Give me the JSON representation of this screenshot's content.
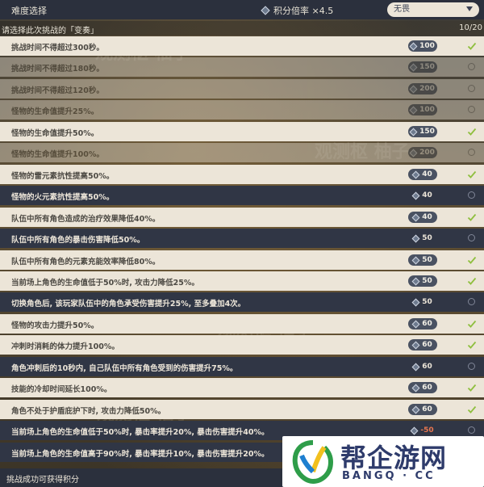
{
  "header": {
    "title": "难度选择",
    "rate_label": "积分倍率 ×4.5",
    "difficulty_select": "无畏"
  },
  "subheader": {
    "prompt": "请选择此次挑战的「变奏」",
    "count": "10/20"
  },
  "rows": [
    {
      "text": "挑战时间不得超过300秒。",
      "points": "100",
      "style": "light",
      "state": "checked"
    },
    {
      "text": "挑战时间不得超过180秒。",
      "points": "150",
      "style": "light",
      "state": "disabled"
    },
    {
      "text": "挑战时间不得超过120秒。",
      "points": "200",
      "style": "light",
      "state": "disabled"
    },
    {
      "text": "怪物的生命值提升25%。",
      "points": "100",
      "style": "light",
      "state": "disabled"
    },
    {
      "text": "怪物的生命值提升50%。",
      "points": "150",
      "style": "light",
      "state": "checked"
    },
    {
      "text": "怪物的生命值提升100%。",
      "points": "200",
      "style": "light",
      "state": "disabled"
    },
    {
      "text": "怪物的雷元素抗性提高50%。",
      "points": "40",
      "style": "light",
      "state": "checked"
    },
    {
      "text": "怪物的火元素抗性提高50%。",
      "points": "40",
      "style": "dark",
      "state": "unchecked"
    },
    {
      "text": "队伍中所有角色造成的治疗效果降低40%。",
      "points": "40",
      "style": "light",
      "state": "checked"
    },
    {
      "text": "队伍中所有角色的暴击伤害降低50%。",
      "points": "50",
      "style": "dark",
      "state": "unchecked"
    },
    {
      "text": "队伍中所有角色的元素充能效率降低80%。",
      "points": "50",
      "style": "light",
      "state": "checked"
    },
    {
      "text": "当前场上角色的生命值低于50%时, 攻击力降低25%。",
      "points": "50",
      "style": "light",
      "state": "checked"
    },
    {
      "text": "切换角色后, 该玩家队伍中的角色承受伤害提升25%, 至多叠加4次。",
      "points": "50",
      "style": "dark",
      "state": "unchecked"
    },
    {
      "text": "怪物的攻击力提升50%。",
      "points": "60",
      "style": "light",
      "state": "checked"
    },
    {
      "text": "冲刺时消耗的体力提升100%。",
      "points": "60",
      "style": "light",
      "state": "checked"
    },
    {
      "text": "角色冲刺后的10秒内, 自己队伍中所有角色受到的伤害提升75%。",
      "points": "60",
      "style": "dark",
      "state": "unchecked"
    },
    {
      "text": "技能的冷却时间延长100%。",
      "points": "60",
      "style": "light",
      "state": "checked"
    },
    {
      "text": "角色不处于护盾庇护下时, 攻击力降低50%。",
      "points": "60",
      "style": "light",
      "state": "checked"
    },
    {
      "text": "当前场上角色的生命值低于50%时, 暴击率提升20%, 暴击伤害提升40%。",
      "points": "-50",
      "style": "dark",
      "state": "unchecked"
    },
    {
      "text": "当前场上角色的生命值高于90%时, 暴击率提升10%, 暴击伤害提升20%。",
      "points": "",
      "style": "dark",
      "state": "unchecked"
    }
  ],
  "footer": {
    "label": "挑战成功可获得积分"
  },
  "watermarks": [
    "观测枢 柚子",
    "观测枢 柚子",
    "观测枢 柚子",
    "观测枢 柚子"
  ],
  "logo": {
    "name": "帮企游网",
    "sub": "BANGQ · CC"
  },
  "colors": {
    "light_row": "#ece5d8",
    "dark_row": "#303645",
    "check": "#8fbf3f",
    "negative": "#e87650"
  }
}
